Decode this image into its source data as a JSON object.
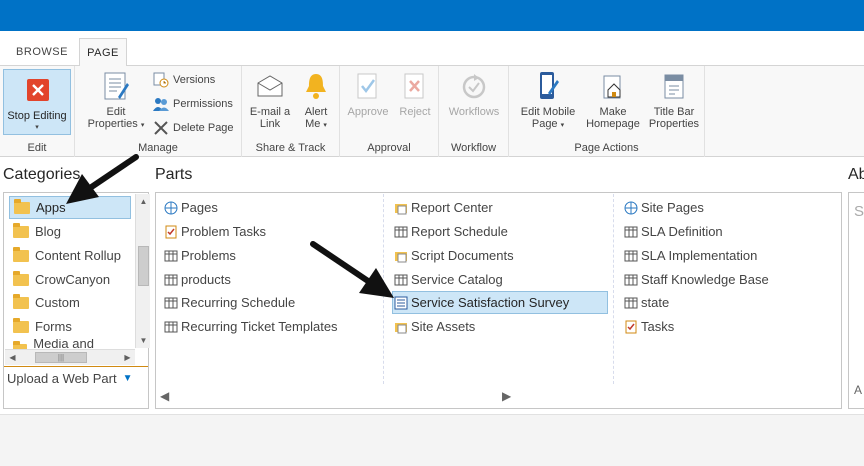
{
  "ribbon_tabs": [
    "BROWSE",
    "PAGE"
  ],
  "ribbon": {
    "edit": {
      "stop_editing": "Stop Editing",
      "label": "Edit"
    },
    "manage": {
      "edit_properties_1": "Edit",
      "edit_properties_2": "Properties",
      "versions": "Versions",
      "permissions": "Permissions",
      "delete_page": "Delete Page",
      "label": "Manage"
    },
    "share_track": {
      "email_1": "E-mail a",
      "email_2": "Link",
      "alert_1": "Alert",
      "alert_2": "Me",
      "label": "Share & Track"
    },
    "approval": {
      "approve": "Approve",
      "reject": "Reject",
      "label": "Approval"
    },
    "workflow": {
      "workflows": "Workflows",
      "label": "Workflow"
    },
    "page_actions": {
      "mobile_1": "Edit Mobile",
      "mobile_2": "Page",
      "home_1": "Make",
      "home_2": "Homepage",
      "title_1": "Title Bar",
      "title_2": "Properties",
      "label": "Page Actions"
    }
  },
  "categories": {
    "title": "Categories",
    "items": [
      "Apps",
      "Blog",
      "Content Rollup",
      "CrowCanyon",
      "Custom",
      "Forms",
      "Media and Content"
    ],
    "selected": "Apps",
    "upload": "Upload a Web Part"
  },
  "parts": {
    "title": "Parts",
    "col1": [
      "Pages",
      "Problem Tasks",
      "Problems",
      "products",
      "Recurring Schedule",
      "Recurring Ticket Templates"
    ],
    "col2": [
      "Report Center",
      "Report Schedule",
      "Script Documents",
      "Service Catalog",
      "Service Satisfaction Survey",
      "Site Assets"
    ],
    "col3": [
      "Site Pages",
      "SLA Definition",
      "SLA Implementation",
      "Staff Knowledge Base",
      "state",
      "Tasks"
    ],
    "selected": "Service Satisfaction Survey"
  },
  "about": {
    "title": "Ab",
    "s": "S",
    "a": "A"
  }
}
